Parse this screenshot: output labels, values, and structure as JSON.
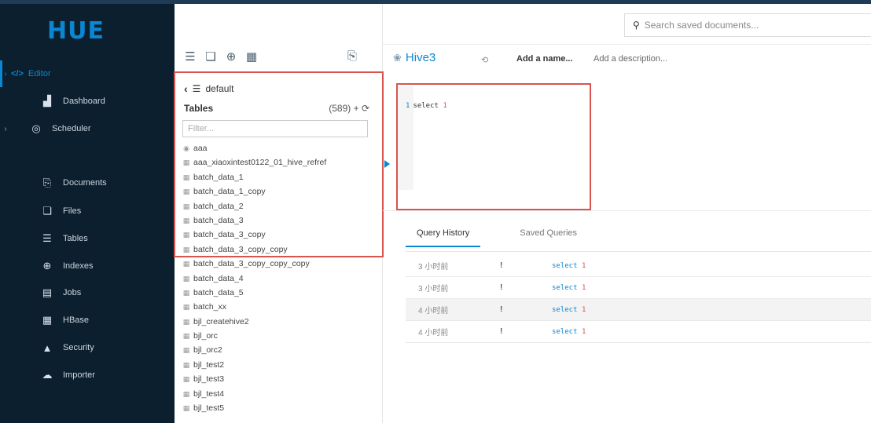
{
  "app": {
    "logo_text": "HUE",
    "accent": "#0b86d1",
    "nav_bg": "#0b1f2e",
    "highlight_color": "#d9534f"
  },
  "nav": {
    "items": [
      {
        "label": "Editor",
        "icon": "code-icon",
        "glyph": "</>",
        "caret": true,
        "active": true
      },
      {
        "label": "Dashboard",
        "icon": "dashboard-icon",
        "glyph": "▟",
        "caret": false
      },
      {
        "label": "Scheduler",
        "icon": "scheduler-icon",
        "glyph": "◎",
        "caret": true
      },
      {
        "label": "Documents",
        "icon": "documents-icon",
        "glyph": "⎘",
        "caret": false
      },
      {
        "label": "Files",
        "icon": "files-icon",
        "glyph": "❏",
        "caret": false
      },
      {
        "label": "Tables",
        "icon": "tables-icon",
        "glyph": "☰",
        "caret": false
      },
      {
        "label": "Indexes",
        "icon": "indexes-icon",
        "glyph": "⊕",
        "caret": false
      },
      {
        "label": "Jobs",
        "icon": "jobs-icon",
        "glyph": "▤",
        "caret": false
      },
      {
        "label": "HBase",
        "icon": "hbase-icon",
        "glyph": "▦",
        "caret": false
      },
      {
        "label": "Security",
        "icon": "lock-icon",
        "glyph": "▲",
        "caret": false
      },
      {
        "label": "Importer",
        "icon": "cloud-upload-icon",
        "glyph": "☁",
        "caret": false
      }
    ]
  },
  "assist": {
    "database": "default",
    "tables_label": "Tables",
    "tables_count": "(589)",
    "filter_placeholder": "Filter...",
    "tables": [
      {
        "name": "aaa",
        "kind": "view"
      },
      {
        "name": "aaa_xiaoxintest0122_01_hive_refref",
        "kind": "table"
      },
      {
        "name": "batch_data_1",
        "kind": "table"
      },
      {
        "name": "batch_data_1_copy",
        "kind": "table"
      },
      {
        "name": "batch_data_2",
        "kind": "table"
      },
      {
        "name": "batch_data_3",
        "kind": "table"
      },
      {
        "name": "batch_data_3_copy",
        "kind": "table"
      },
      {
        "name": "batch_data_3_copy_copy",
        "kind": "table"
      },
      {
        "name": "batch_data_3_copy_copy_copy",
        "kind": "table"
      },
      {
        "name": "batch_data_4",
        "kind": "table"
      },
      {
        "name": "batch_data_5",
        "kind": "table"
      },
      {
        "name": "batch_xx",
        "kind": "table"
      },
      {
        "name": "bjl_createhive2",
        "kind": "table"
      },
      {
        "name": "bjl_orc",
        "kind": "table"
      },
      {
        "name": "bjl_orc2",
        "kind": "table"
      },
      {
        "name": "bjl_test2",
        "kind": "table"
      },
      {
        "name": "bjl_test3",
        "kind": "table"
      },
      {
        "name": "bjl_test4",
        "kind": "table"
      },
      {
        "name": "bjl_test5",
        "kind": "table"
      }
    ]
  },
  "search": {
    "placeholder": "Search saved documents..."
  },
  "editor": {
    "title": "Hive3",
    "name_placeholder": "Add a name...",
    "description_placeholder": "Add a description...",
    "line_number": "1",
    "code_keyword": "select",
    "code_value": "1"
  },
  "history": {
    "tabs": [
      "Query History",
      "Saved Queries"
    ],
    "rows": [
      {
        "time": "3 小时前",
        "status": "!",
        "keyword": "select",
        "value": "1"
      },
      {
        "time": "3 小时前",
        "status": "!",
        "keyword": "select",
        "value": "1"
      },
      {
        "time": "4 小时前",
        "status": "!",
        "keyword": "select",
        "value": "1"
      },
      {
        "time": "4 小时前",
        "status": "!",
        "keyword": "select",
        "value": "1"
      }
    ]
  }
}
